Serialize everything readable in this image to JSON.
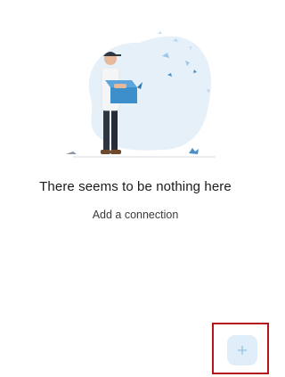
{
  "empty_state": {
    "illustration": "person-holding-box-illustration",
    "title": "There seems to be nothing here",
    "subtitle": "Add a connection"
  },
  "fab": {
    "icon": "plus-icon",
    "background": "#dfeef9",
    "icon_color": "#9cc5e2"
  },
  "highlight": {
    "color": "#b3151b"
  }
}
